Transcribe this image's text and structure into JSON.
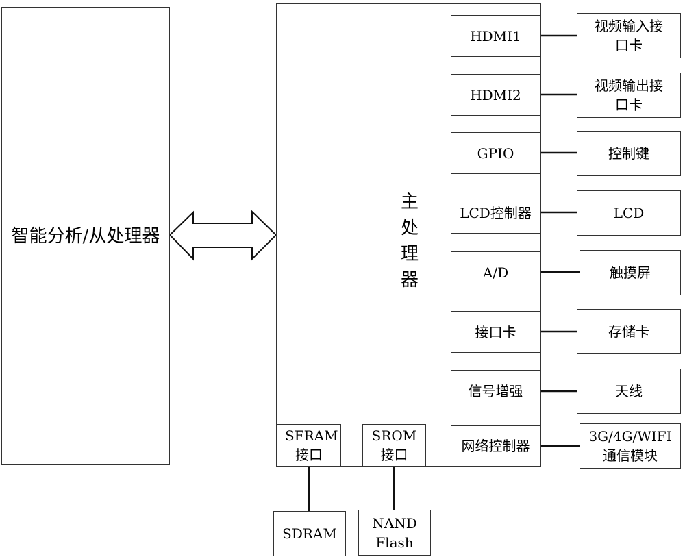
{
  "slave_processor": {
    "label": "智能分析/从处理器"
  },
  "main_processor": {
    "label": "主处理器"
  },
  "bus_arrow": {
    "icon": "double-arrow-icon"
  },
  "interfaces": [
    {
      "id": "hdmi1",
      "label": "HDMI1",
      "peripheral": "视频输入接口卡"
    },
    {
      "id": "hdmi2",
      "label": "HDMI2",
      "peripheral": "视频输出接口卡"
    },
    {
      "id": "gpio",
      "label": "GPIO",
      "peripheral": "控制键"
    },
    {
      "id": "lcd-controller",
      "label": "LCD控制器",
      "peripheral": "LCD"
    },
    {
      "id": "ad",
      "label": "A/D",
      "peripheral": "触摸屏"
    },
    {
      "id": "card-interface",
      "label": "接口卡",
      "peripheral": "存储卡"
    },
    {
      "id": "signal-boost",
      "label": "信号增强",
      "peripheral": "天线"
    },
    {
      "id": "network-controller",
      "label": "网络控制器",
      "peripheral": "3G/4G/WIFI通信模块"
    }
  ],
  "memory_interfaces": [
    {
      "id": "sfram",
      "label": "SFRAM接口",
      "device": "SDRAM"
    },
    {
      "id": "srom",
      "label": "SROM接口",
      "device": "NAND Flash"
    }
  ]
}
